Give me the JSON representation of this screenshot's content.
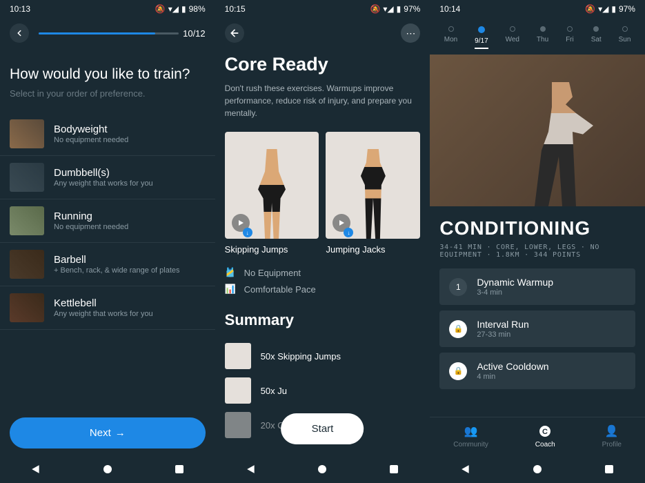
{
  "screen1": {
    "status": {
      "time": "10:13",
      "battery": "98%"
    },
    "progress": {
      "current": 10,
      "total": 12,
      "text": "10/12"
    },
    "title": "How would you like to train?",
    "subtitle": "Select in your order of preference.",
    "items": [
      {
        "name": "Bodyweight",
        "desc": "No equipment needed"
      },
      {
        "name": "Dumbbell(s)",
        "desc": "Any weight that works for you"
      },
      {
        "name": "Running",
        "desc": "No equipment needed"
      },
      {
        "name": "Barbell",
        "desc": "+ Bench, rack, & wide range of plates"
      },
      {
        "name": "Kettlebell",
        "desc": "Any weight that works for you"
      }
    ],
    "next": "Next"
  },
  "screen2": {
    "status": {
      "time": "10:15",
      "battery": "97%"
    },
    "title": "Core Ready",
    "desc": "Don't rush these exercises. Warmups improve performance, reduce risk of injury, and prepare you mentally.",
    "exercises": [
      {
        "name": "Skipping Jumps"
      },
      {
        "name": "Jumping Jacks"
      }
    ],
    "meta": [
      {
        "icon": "equipment",
        "text": "No Equipment"
      },
      {
        "icon": "pace",
        "text": "Comfortable Pace"
      }
    ],
    "summaryTitle": "Summary",
    "summary": [
      {
        "text": "50x Skipping Jumps"
      },
      {
        "text": "50x Ju"
      },
      {
        "text": "20x Crunches"
      }
    ],
    "start": "Start"
  },
  "screen3": {
    "status": {
      "time": "10:14",
      "battery": "97%"
    },
    "days": [
      {
        "label": "Mon",
        "state": "outline"
      },
      {
        "label": "9/17",
        "state": "active"
      },
      {
        "label": "Wed",
        "state": "outline"
      },
      {
        "label": "Thu",
        "state": "filled"
      },
      {
        "label": "Fri",
        "state": "outline"
      },
      {
        "label": "Sat",
        "state": "filled"
      },
      {
        "label": "Sun",
        "state": "outline"
      }
    ],
    "title": "CONDITIONING",
    "meta": "34-41 MIN · CORE, LOWER, LEGS · NO EQUIPMENT · 1.8KM · 344 POINTS",
    "phases": [
      {
        "badge": "1",
        "locked": false,
        "name": "Dynamic Warmup",
        "time": "3-4 min"
      },
      {
        "badge": "lock",
        "locked": true,
        "name": "Interval Run",
        "time": "27-33 min"
      },
      {
        "badge": "lock",
        "locked": true,
        "name": "Active Cooldown",
        "time": "4 min"
      }
    ],
    "tabs": [
      {
        "label": "Community",
        "icon": "people",
        "active": false
      },
      {
        "label": "Coach",
        "icon": "coach",
        "active": true
      },
      {
        "label": "Profile",
        "icon": "profile",
        "active": false
      }
    ]
  }
}
